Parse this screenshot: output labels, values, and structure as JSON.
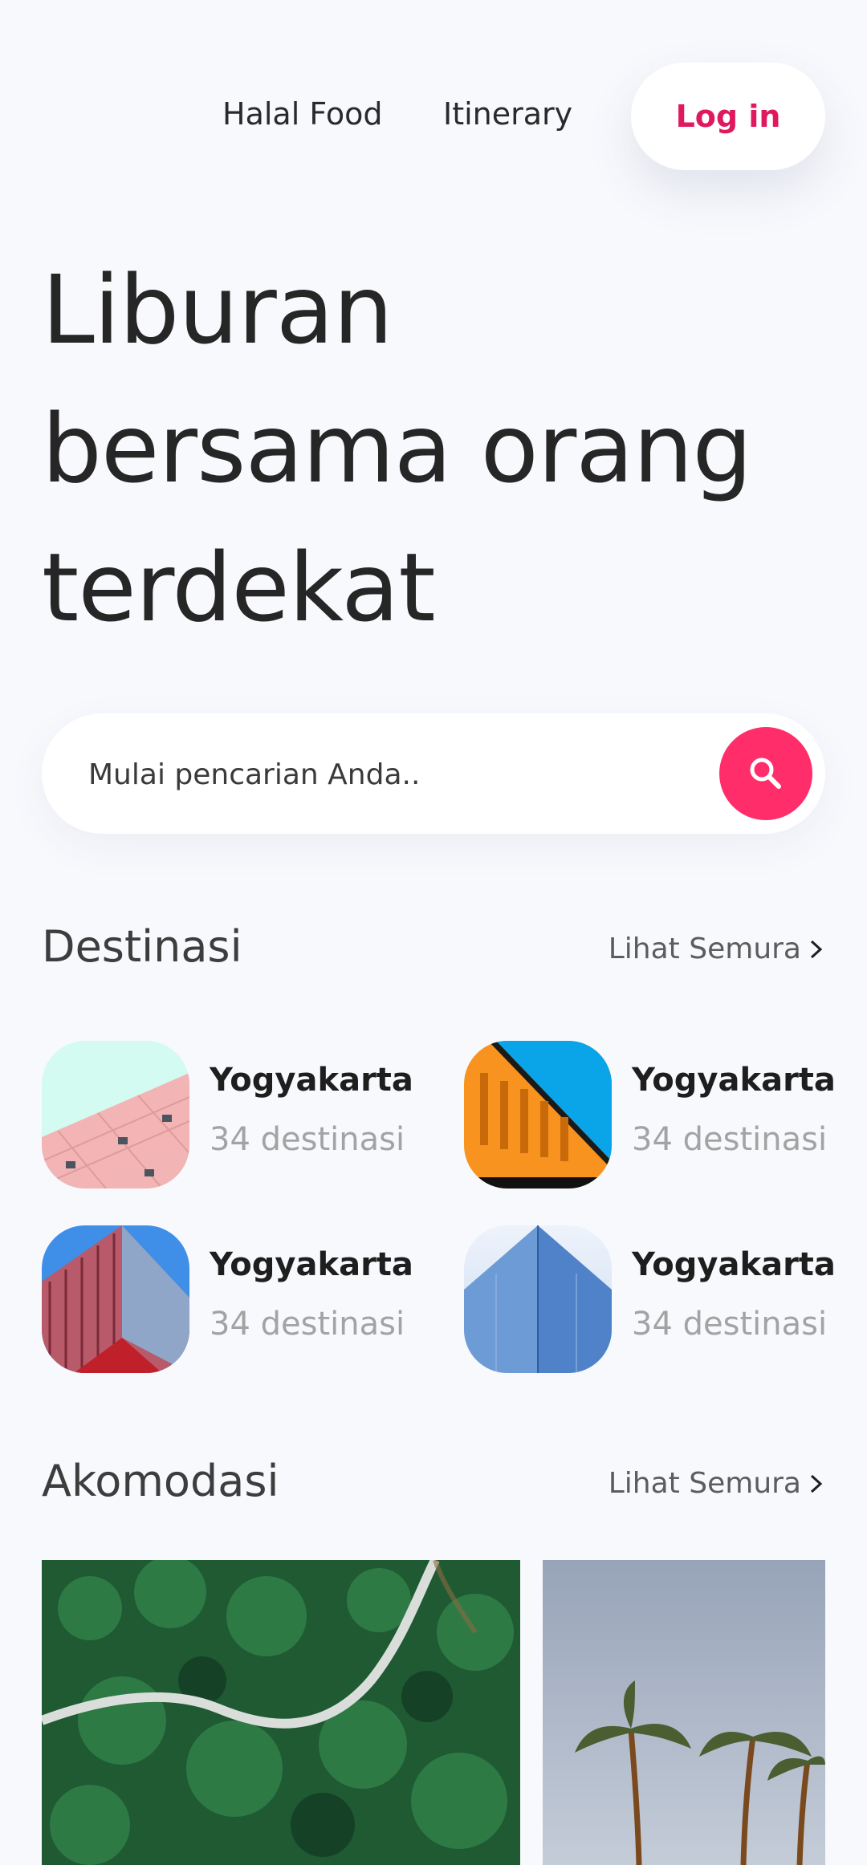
{
  "nav": {
    "links": [
      "Halal Food",
      "Itinerary"
    ],
    "login_label": "Log in"
  },
  "hero": {
    "lines": [
      "Liburan",
      "bersama orang",
      "terdekat"
    ]
  },
  "search": {
    "placeholder": "Mulai pencarian Anda..",
    "button_icon": "search-icon"
  },
  "destinations": {
    "title": "Destinasi",
    "see_all": "Lihat Semura",
    "items": [
      {
        "name": "Yogyakarta",
        "count": "34 destinasi",
        "image": "pink-building-photo"
      },
      {
        "name": "Yogyakarta",
        "count": "34 destinasi",
        "image": "orange-building-photo"
      },
      {
        "name": "Yogyakarta",
        "count": "34 destinasi",
        "image": "red-glass-tower-photo"
      },
      {
        "name": "Yogyakarta",
        "count": "34 destinasi",
        "image": "blue-glass-building-photo"
      }
    ]
  },
  "accommodations": {
    "title": "Akomodasi",
    "see_all": "Lihat Semura",
    "items": [
      {
        "image": "forest-road-aerial-photo"
      },
      {
        "image": "palm-trees-photo"
      }
    ]
  },
  "colors": {
    "accent": "#ff2d6a",
    "login_text": "#e0195f",
    "background": "#f8f9fd"
  }
}
